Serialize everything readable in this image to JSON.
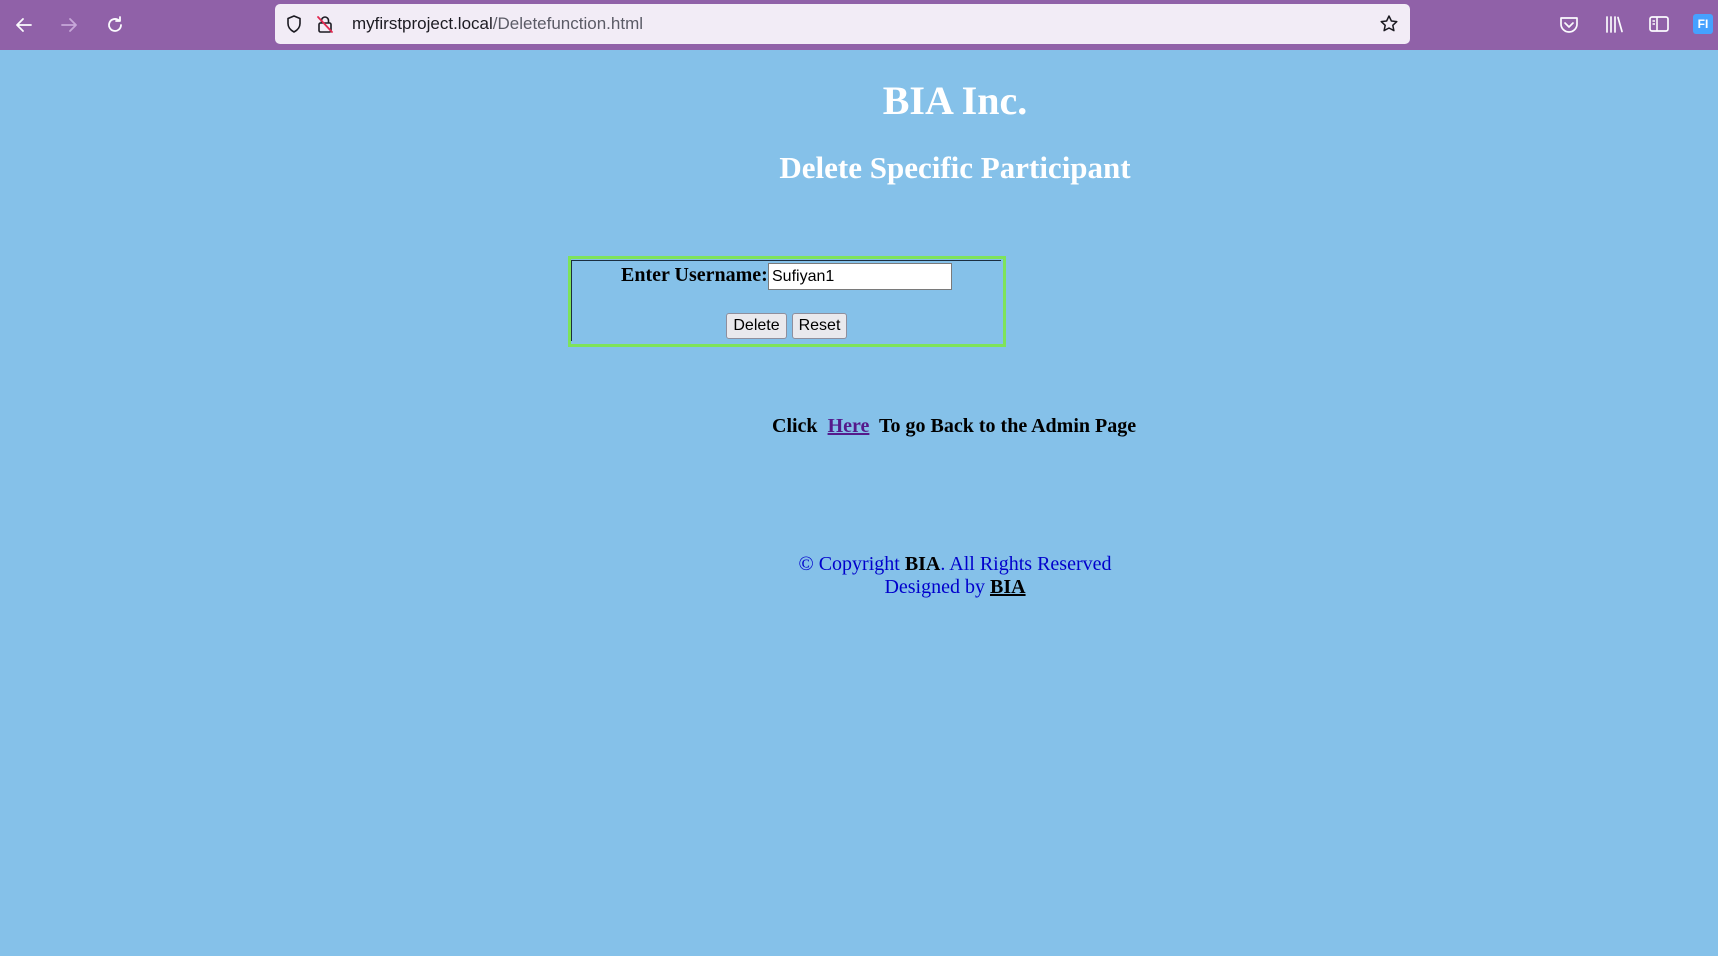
{
  "browser": {
    "url_host": "myfirstproject.local",
    "url_path": "/Deletefunction.html",
    "profile_initials": "FI",
    "icons": [
      "back-arrow-icon",
      "forward-arrow-icon",
      "reload-icon",
      "shield-icon",
      "insecure-lock-icon",
      "bookmark-star-icon",
      "pocket-icon",
      "library-icon",
      "sidebar-icon"
    ]
  },
  "page": {
    "title": "BIA Inc.",
    "subtitle": "Delete Specific Participant",
    "form": {
      "label": "Enter Username:",
      "username_value": "Sufiyan1",
      "delete_label": "Delete",
      "reset_label": "Reset"
    },
    "back": {
      "prefix": "Click  ",
      "link_text": "Here",
      "suffix": "  To go Back to the Admin Page"
    },
    "footer": {
      "copyright_prefix": "© Copyright ",
      "copyright_brand": "BIA",
      "copyright_suffix": ". All Rights Reserved",
      "designed_prefix": "Designed by ",
      "designed_brand": "BIA"
    }
  },
  "colors": {
    "page_background": "#85c1e9",
    "toolbar": "#9061a8",
    "form_border": "#7ee35a",
    "footer_text": "#0000cc",
    "link": "#551a8b"
  }
}
